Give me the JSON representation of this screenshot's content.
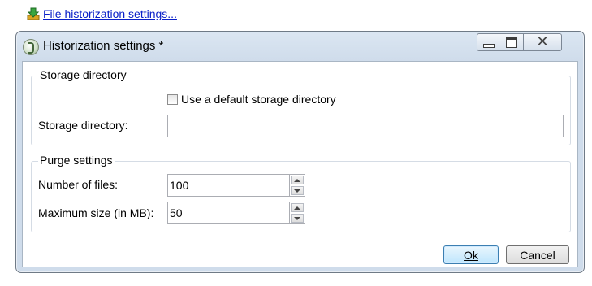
{
  "top_link": {
    "text": "File historization settings...",
    "icon": "download-arrow-icon"
  },
  "window": {
    "title": "Historization settings *",
    "controls": {
      "minimize": "minimize-icon",
      "maximize": "maximize-icon",
      "close": "close-icon"
    }
  },
  "storage": {
    "group_title": "Storage directory",
    "default_checkbox_label": "Use a default storage directory",
    "default_checked": false,
    "directory_label": "Storage directory:",
    "directory_value": ""
  },
  "purge": {
    "group_title": "Purge settings",
    "num_files_label": "Number of files:",
    "num_files_value": "100",
    "max_size_label": "Maximum size (in MB):",
    "max_size_value": "50"
  },
  "buttons": {
    "ok": "Ok",
    "cancel": "Cancel"
  }
}
